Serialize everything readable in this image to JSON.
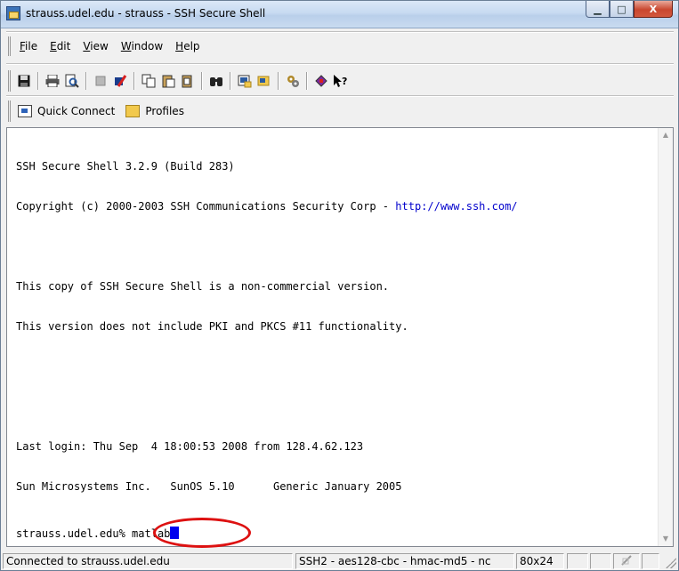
{
  "window": {
    "title": "strauss.udel.edu - strauss - SSH Secure Shell",
    "controls": {
      "minimize": "▁",
      "maximize": "□",
      "close": "X"
    }
  },
  "menu": [
    {
      "label": "File",
      "accel": "F",
      "rest": "ile"
    },
    {
      "label": "Edit",
      "accel": "E",
      "rest": "dit"
    },
    {
      "label": "View",
      "accel": "V",
      "rest": "iew"
    },
    {
      "label": "Window",
      "accel": "W",
      "rest": "indow"
    },
    {
      "label": "Help",
      "accel": "H",
      "rest": "elp"
    }
  ],
  "toolbar": {
    "icons": [
      "save-icon",
      "print-icon",
      "print-preview-icon",
      "disconnect-icon",
      "new-connection-icon",
      "copy-icon",
      "paste-icon",
      "paste-special-icon",
      "find-icon",
      "new-terminal-icon",
      "file-transfer-icon",
      "settings-icon",
      "help-icon",
      "context-help-icon"
    ]
  },
  "quick": {
    "connect_label": "Quick Connect",
    "profiles_label": "Profiles"
  },
  "terminal": {
    "lines": [
      "SSH Secure Shell 3.2.9 (Build 283)",
      "Copyright (c) 2000-2003 SSH Communications Security Corp - ",
      "",
      "This copy of SSH Secure Shell is a non-commercial version.",
      "This version does not include PKI and PKCS #11 functionality.",
      "",
      "",
      "Last login: Thu Sep  4 18:00:53 2008 from 128.4.62.123",
      "Sun Microsystems Inc.   SunOS 5.10      Generic January 2005"
    ],
    "copyright_link": "http://www.ssh.com/",
    "prompt": "strauss.udel.edu% ",
    "command": "matlab",
    "annotation_color": "#dd1111",
    "cursor_color": "#0000ee"
  },
  "status": {
    "connection": "Connected to strauss.udel.edu",
    "cipher": "SSH2 - aes128-cbc - hmac-md5 - nc",
    "size": "80x24"
  }
}
